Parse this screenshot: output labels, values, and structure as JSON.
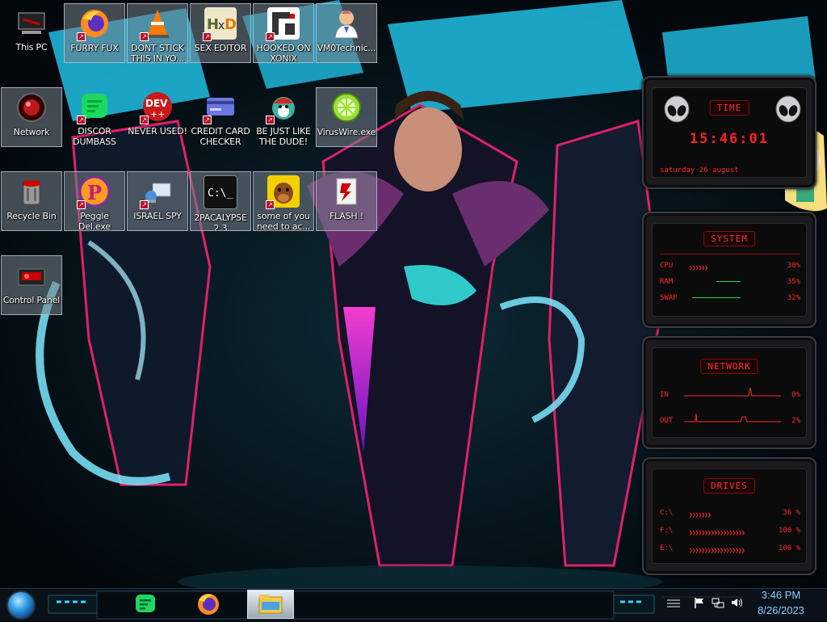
{
  "desktop": {
    "icons": [
      {
        "label": "This PC",
        "icon": "computer-icon"
      },
      {
        "label": "FURRY FUX",
        "icon": "firefox-icon"
      },
      {
        "label": "DONT STICK THIS IN YO...",
        "icon": "traffic-cone-icon"
      },
      {
        "label": "SEX EDITOR",
        "icon": "hxd-icon"
      },
      {
        "label": "HOOKED ON XONIX",
        "icon": "game-icon"
      },
      {
        "label": "VM0Technic...",
        "icon": "doctor-icon"
      },
      {
        "label": "Network",
        "icon": "network-icon"
      },
      {
        "label": "DISCOR DUMBASS",
        "icon": "chat-app-icon"
      },
      {
        "label": "NEVER USED!",
        "icon": "dev-cpp-icon"
      },
      {
        "label": "CREDIT CARD CHECKER",
        "icon": "credit-card-icon"
      },
      {
        "label": "BE JUST LIKE THE DUDE!",
        "icon": "santa-icon"
      },
      {
        "label": "VirusWire.exe",
        "icon": "lime-icon"
      },
      {
        "label": "Recycle Bin",
        "icon": "recycle-bin-icon"
      },
      {
        "label": "Peggle Del.exe",
        "icon": "peggle-icon"
      },
      {
        "label": "ISRAEL SPY",
        "icon": "network-adapter-icon"
      },
      {
        "label": "2PACALYPSE 2.3",
        "icon": "terminal-icon"
      },
      {
        "label": "some of you need to ac...",
        "icon": "dog-icon"
      },
      {
        "label": "FLASH !",
        "icon": "flash-icon"
      },
      {
        "label": "Control Panel",
        "icon": "control-panel-icon"
      }
    ]
  },
  "widgets": {
    "time": {
      "title": "TIME",
      "clock": "15:46:01",
      "date": "saturday 26 august"
    },
    "system": {
      "title": "SYSTEM",
      "rows": [
        {
          "label": "CPU",
          "value": "30%"
        },
        {
          "label": "RAM",
          "value": "35%"
        },
        {
          "label": "SWAP",
          "value": "32%"
        }
      ]
    },
    "network": {
      "title": "NETWORK",
      "rows": [
        {
          "label": "IN",
          "value": "0%"
        },
        {
          "label": "OUT",
          "value": "2%"
        }
      ]
    },
    "drives": {
      "title": "DRIVES",
      "rows": [
        {
          "label": "C:\\",
          "value": "36 %"
        },
        {
          "label": "F:\\",
          "value": "100 %"
        },
        {
          "label": "E:\\",
          "value": "100 %"
        }
      ]
    }
  },
  "taskbar": {
    "apps": [
      {
        "name": "chat-app",
        "icon": "chat-app-icon"
      },
      {
        "name": "firefox",
        "icon": "firefox-icon"
      },
      {
        "name": "file-explorer",
        "icon": "folder-icon",
        "active": true
      }
    ],
    "time": "3:46 PM",
    "date": "8/26/2023",
    "tray_icons": [
      "flag-icon",
      "network-icon",
      "volume-icon"
    ]
  },
  "colors": {
    "accent_red": "#ff2a2a",
    "taskbar_blue": "#8ccfff",
    "wallpaper_cyan": "#1fb5d8",
    "wallpaper_magenta": "#e0206a"
  }
}
